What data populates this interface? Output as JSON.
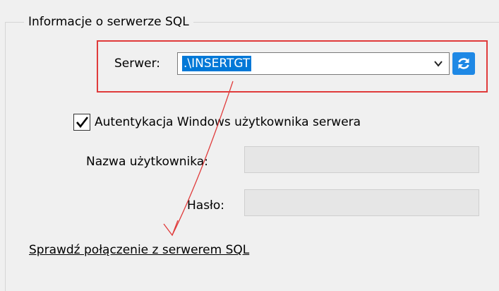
{
  "group": {
    "title": "Informacje o serwerze SQL"
  },
  "server": {
    "label": "Serwer:",
    "value": ".\\INSERTGT",
    "refresh_icon": "refresh-icon",
    "dropdown_icon": "chevron-down-icon"
  },
  "auth": {
    "checkbox_label": "Autentykacja Windows użytkownika serwera",
    "checked": true
  },
  "credentials": {
    "username_label": "Nazwa użytkownika:",
    "username_value": "",
    "password_label": "Hasło:",
    "password_value": ""
  },
  "actions": {
    "test_connection_link": "Sprawdź połączenie z serwerem SQL"
  },
  "colors": {
    "annotation": "#e03b3b",
    "selection": "#0078d7",
    "refresh_button": "#1e88e5"
  }
}
